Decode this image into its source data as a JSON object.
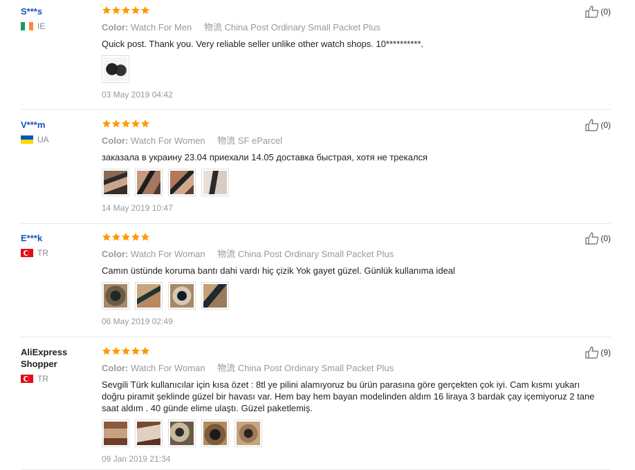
{
  "labels": {
    "color": "Color:",
    "shipping": "物流"
  },
  "reviews": [
    {
      "user": "S***s",
      "country": "IE",
      "flag": "ie",
      "color": "Watch For Men",
      "shipping": "China Post Ordinary Small Packet Plus",
      "text": "Quick post. Thank you. Very reliable seller unlike other watch shops. 10**********.",
      "date": "03 May 2019 04:42",
      "useful": "(0)",
      "rating": 5
    },
    {
      "user": "V***m",
      "country": "UA",
      "flag": "ua",
      "color": "Watch For Women",
      "shipping": "SF eParcel",
      "text": "заказала в украину 23.04 приехали 14.05 доставка быстрая, хотя не трекался",
      "date": "14 May 2019 10:47",
      "useful": "(0)",
      "rating": 5
    },
    {
      "user": "E***k",
      "country": "TR",
      "flag": "tr",
      "color": "Watch For Woman",
      "shipping": "China Post Ordinary Small Packet Plus",
      "text": "Camın üstünde koruma bantı dahi vardı hiç çizik Yok gayet güzel. Günlük kullanıma ideal",
      "date": "06 May 2019 02:49",
      "useful": "(0)",
      "rating": 5
    },
    {
      "user": "AliExpress Shopper",
      "country": "TR",
      "flag": "tr",
      "color": "Watch For Woman",
      "shipping": "China Post Ordinary Small Packet Plus",
      "text": "Sevgili Türk kullanıcılar için kısa özet : 8tl ye pilini alamıyoruz bu ürün parasına göre gerçekten çok iyi. Cam kısmı yukarı doğru piramit şeklinde güzel bir havası var. Hem bay hem bayan modelinden aldım 16 liraya 3 bardak çay içemiyoruz 2 tane saat aldım . 40 günde elime ulaştı. Güzel paketlemiş.",
      "date": "09 Jan 2019 21:34",
      "useful": "(9)",
      "rating": 5
    }
  ]
}
